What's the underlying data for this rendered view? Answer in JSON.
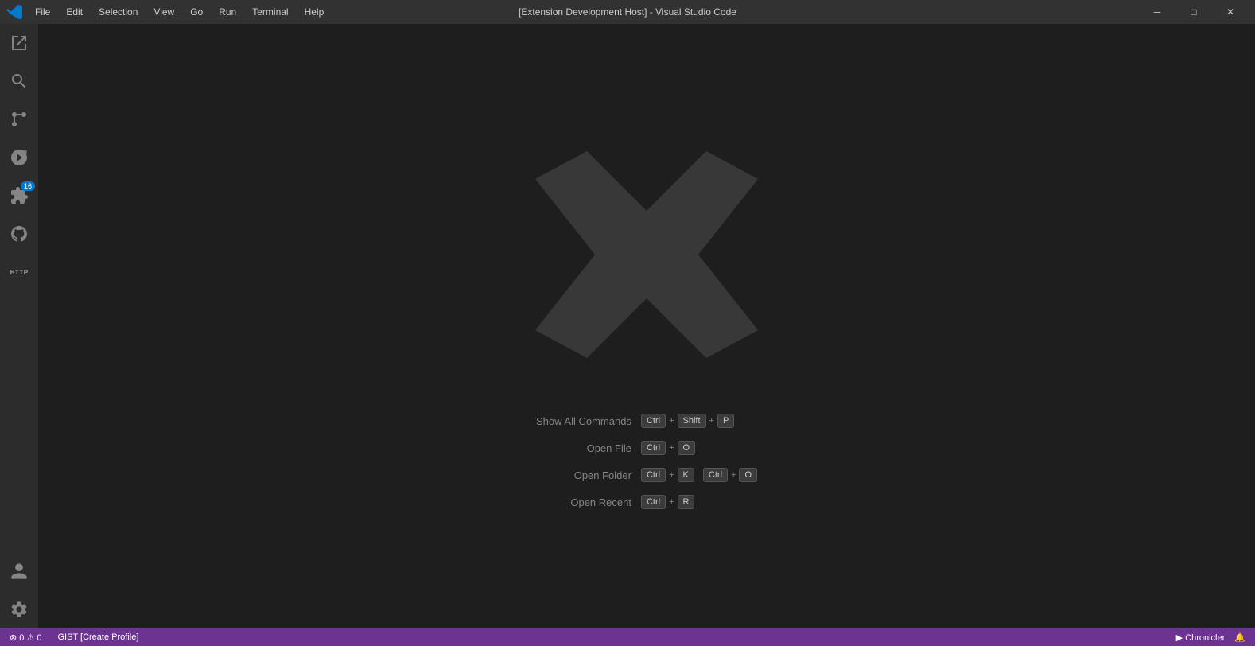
{
  "titlebar": {
    "title": "[Extension Development Host] - Visual Studio Code",
    "menu_items": [
      "File",
      "Edit",
      "Selection",
      "View",
      "Go",
      "Run",
      "Terminal",
      "Help"
    ],
    "min_label": "─",
    "max_label": "□",
    "close_label": "✕"
  },
  "activitybar": {
    "items": [
      {
        "id": "explorer",
        "title": "Explorer"
      },
      {
        "id": "search",
        "title": "Search"
      },
      {
        "id": "scm",
        "title": "Source Control"
      },
      {
        "id": "debug",
        "title": "Run and Debug"
      },
      {
        "id": "extensions",
        "title": "Extensions",
        "badge": "16"
      },
      {
        "id": "github",
        "title": "GitHub"
      },
      {
        "id": "remote",
        "title": "Remote Explorer"
      }
    ],
    "bottom_items": [
      {
        "id": "account",
        "title": "Account"
      },
      {
        "id": "settings",
        "title": "Manage"
      }
    ]
  },
  "editor": {
    "shortcuts": [
      {
        "label": "Show All Commands",
        "keys": [
          "Ctrl",
          "+",
          "Shift",
          "+",
          "P"
        ]
      },
      {
        "label": "Open File",
        "keys": [
          "Ctrl",
          "+",
          "O"
        ]
      },
      {
        "label": "Open Folder",
        "keys": [
          "Ctrl",
          "+",
          "K",
          "Ctrl",
          "+",
          "O"
        ]
      },
      {
        "label": "Open Recent",
        "keys": [
          "Ctrl",
          "+",
          "R"
        ]
      }
    ]
  },
  "statusbar": {
    "left_items": [
      {
        "id": "remote",
        "text": "⊗ 0  ⚠ 0"
      },
      {
        "id": "branch",
        "text": "GIST [Create Profile]"
      }
    ],
    "right_items": [
      {
        "id": "chronicler",
        "text": "▶ Chronicler"
      },
      {
        "id": "bell",
        "text": "🔔"
      }
    ]
  }
}
